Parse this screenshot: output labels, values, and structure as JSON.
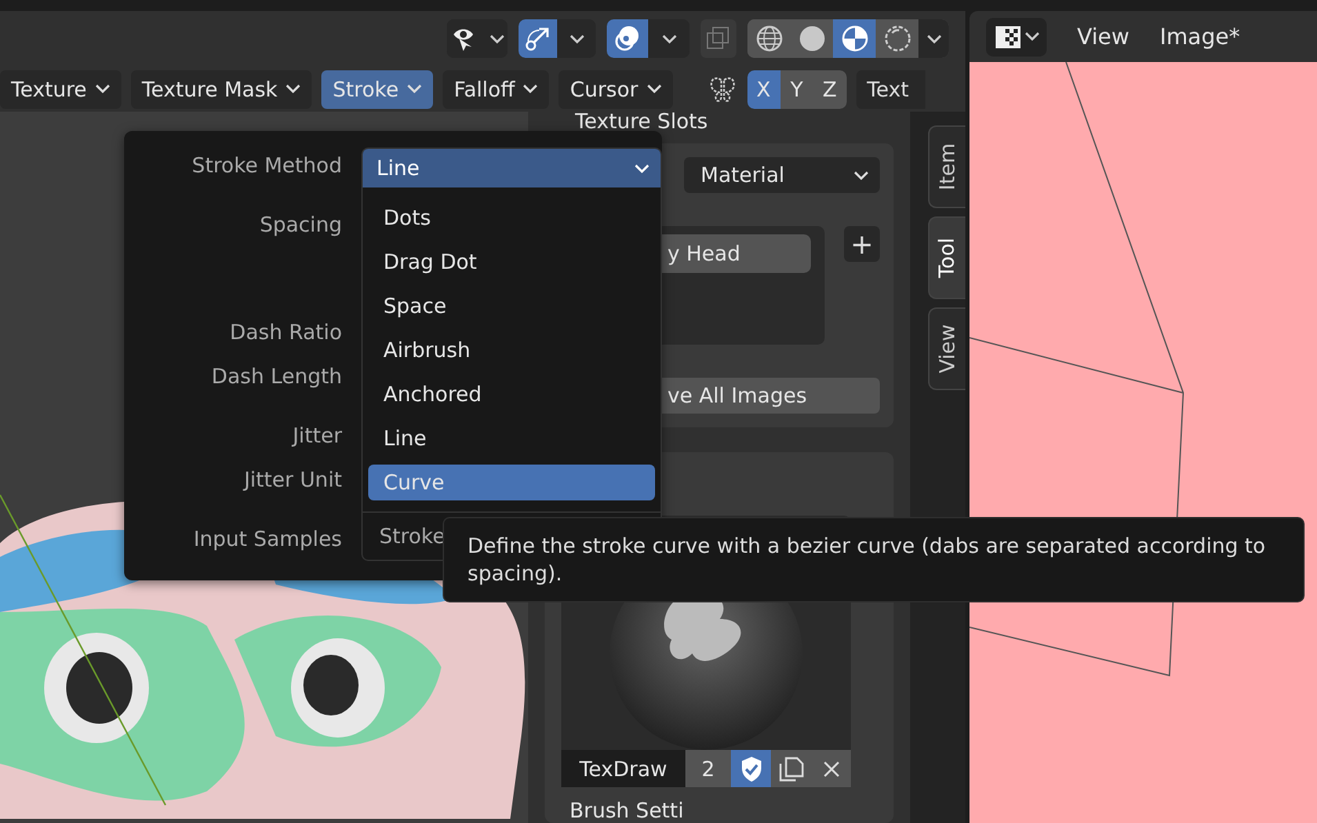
{
  "viewport_header": {
    "gizmo_on": true,
    "overlay_on": true,
    "xray_on": false,
    "shading_modes": [
      {
        "kind": "wireframe",
        "selected": false
      },
      {
        "kind": "solid",
        "selected": false
      },
      {
        "kind": "material",
        "selected": true
      },
      {
        "kind": "rendered",
        "selected": false
      }
    ]
  },
  "menus": [
    {
      "label": "Texture",
      "selected": false
    },
    {
      "label": "Texture Mask",
      "selected": false
    },
    {
      "label": "Stroke",
      "selected": true
    },
    {
      "label": "Falloff",
      "selected": false
    },
    {
      "label": "Cursor",
      "selected": false
    }
  ],
  "mirror_axes": [
    {
      "label": "X",
      "selected": true
    },
    {
      "label": "Y",
      "selected": false
    },
    {
      "label": "Z",
      "selected": false
    }
  ],
  "header_cut_label": "Text",
  "sidebar": {
    "panel_title": "Texture Slots",
    "mode": "Material",
    "slot": "y Head",
    "add_label": "+",
    "save_label": "ve All Images",
    "brush_name": "TexDraw",
    "users": "2",
    "fake_user": true,
    "next_panel_title": "Brush Setti"
  },
  "sidebar_tabs": [
    {
      "label": "Item",
      "selected": false
    },
    {
      "label": "Tool",
      "selected": true
    },
    {
      "label": "View",
      "selected": false
    }
  ],
  "image_editor": {
    "menus": [
      "View",
      "Image*"
    ]
  },
  "stroke_popover": {
    "labels": [
      "Stroke Method",
      "Spacing",
      "Dash Ratio",
      "Dash Length",
      "Jitter",
      "Jitter Unit",
      "Input Samples"
    ],
    "value": "Line"
  },
  "dropdown": {
    "items": [
      {
        "label": "Dots",
        "selected": false
      },
      {
        "label": "Drag Dot",
        "selected": false
      },
      {
        "label": "Space",
        "selected": false
      },
      {
        "label": "Airbrush",
        "selected": false
      },
      {
        "label": "Anchored",
        "selected": false
      },
      {
        "label": "Line",
        "selected": false
      },
      {
        "label": "Curve",
        "selected": true
      }
    ],
    "footer": "Stroke"
  },
  "tooltip": "Define the stroke curve with a bezier curve (dabs are separated according to spacing)."
}
